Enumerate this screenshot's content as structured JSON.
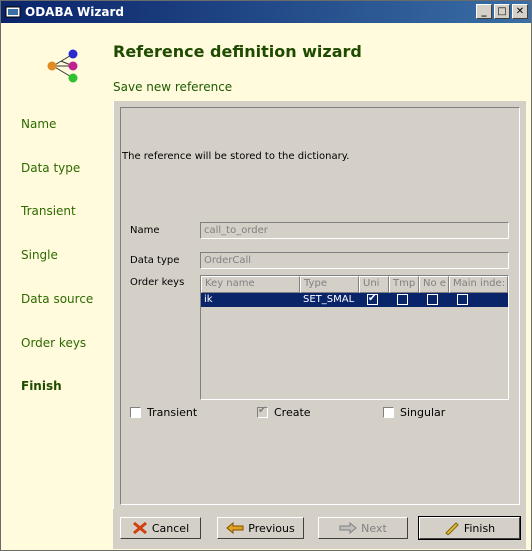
{
  "window": {
    "title": "ODABA Wizard",
    "buttons": [
      "_",
      "□",
      "✕"
    ]
  },
  "header": {
    "title": "Reference definition wizard",
    "subtitle": "Save new reference"
  },
  "steps": [
    {
      "label": "Name",
      "active": false
    },
    {
      "label": "Data type",
      "active": false
    },
    {
      "label": "Transient",
      "active": false
    },
    {
      "label": "Single",
      "active": false
    },
    {
      "label": "Data source",
      "active": false
    },
    {
      "label": "Order keys",
      "active": false
    },
    {
      "label": "Finish",
      "active": true
    }
  ],
  "panel": {
    "info": "The reference will be stored to the dictionary.",
    "name_label": "Name",
    "name_value": "call_to_order",
    "datatype_label": "Data type",
    "datatype_value": "OrderCall",
    "orderkeys_label": "Order keys",
    "table": {
      "headers": [
        "Key name",
        "Type",
        "Uni",
        "Tmp",
        "No e",
        "Main inde:"
      ],
      "rows": [
        {
          "key_name": "ik",
          "type": "SET_SMAL",
          "uni": true,
          "tmp": false,
          "no_e": false,
          "main": false
        }
      ]
    },
    "checkboxes": [
      {
        "label": "Transient",
        "checked": false
      },
      {
        "label": "Create",
        "checked": true
      },
      {
        "label": "Singular",
        "checked": false
      }
    ]
  },
  "buttons": {
    "cancel": "Cancel",
    "previous": "Previous",
    "next": "Next",
    "finish": "Finish"
  }
}
